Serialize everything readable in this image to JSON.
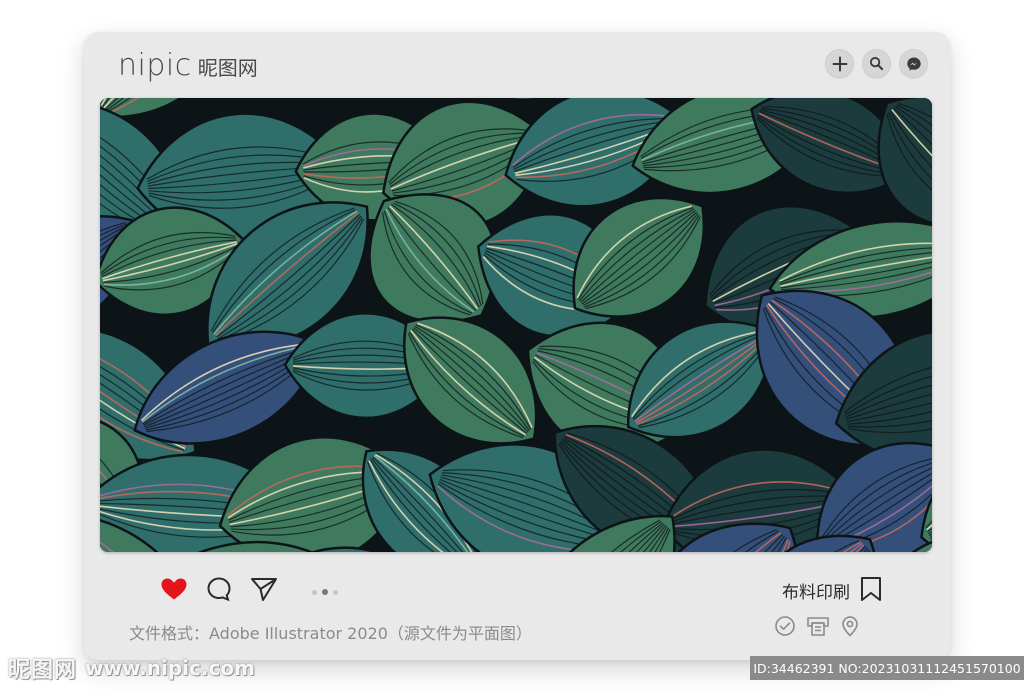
{
  "brand": {
    "name": "nipic",
    "name_cn": "昵图网"
  },
  "top_actions": [
    {
      "name": "add-icon"
    },
    {
      "name": "search-icon"
    },
    {
      "name": "messenger-icon"
    }
  ],
  "artwork": {
    "description_icon": "leaf-pattern",
    "colors": {
      "base": "#1c3b3d",
      "teal": "#2f6e6b",
      "green": "#3f7a5e",
      "blue": "#34507a",
      "coral": "#c4675c",
      "cream": "#e6dcb8",
      "outline": "#0d1417"
    }
  },
  "actions": {
    "like_icon": "heart-icon",
    "comment_icon": "comment-icon",
    "share_icon": "send-icon",
    "like_color": "#e4141b"
  },
  "pagination": {
    "count": 3,
    "active_index": 1
  },
  "category": "布料印刷",
  "caption": "文件格式：Adobe Illustrator 2020（源文件为平面图）",
  "bottom_icons": [
    {
      "name": "check-circle-icon"
    },
    {
      "name": "print-icon"
    },
    {
      "name": "location-pin-icon"
    }
  ],
  "watermark": {
    "logo_cn": "昵图网",
    "url": "www.nipic.com",
    "id_text": "ID:34462391 NO:20231031112451570100"
  }
}
